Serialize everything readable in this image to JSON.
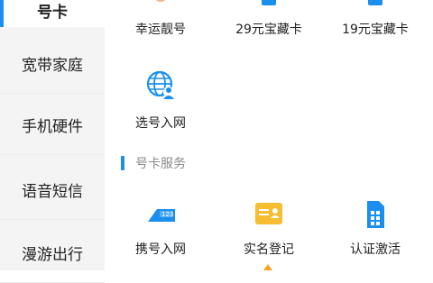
{
  "sidebar": {
    "items": [
      {
        "label": "号卡"
      },
      {
        "label": "宽带家庭"
      },
      {
        "label": "手机硬件"
      },
      {
        "label": "语音短信"
      },
      {
        "label": "漫游出行"
      }
    ],
    "active_index": 0
  },
  "grid_top": {
    "items": [
      {
        "label": "幸运靓号",
        "icon": "lucky-number-icon"
      },
      {
        "label": "29元宝藏卡",
        "icon": "sim-card-blue-icon"
      },
      {
        "label": "19元宝藏卡",
        "icon": "sim-card-blue-icon"
      }
    ]
  },
  "grid_select": {
    "items": [
      {
        "label": "选号入网",
        "icon": "globe-user-icon"
      }
    ]
  },
  "section": {
    "title": "号卡服务"
  },
  "grid_service": {
    "items": [
      {
        "label": "携号入网",
        "icon": "number-transfer-icon"
      },
      {
        "label": "实名登记",
        "icon": "id-card-icon"
      },
      {
        "label": "认证激活",
        "icon": "sim-activate-icon"
      }
    ]
  },
  "colors": {
    "accent": "#1a8ff0",
    "sidebar_bg": "#f4f4f4",
    "orange": "#f5a623",
    "yellow": "#f5bd2f"
  }
}
